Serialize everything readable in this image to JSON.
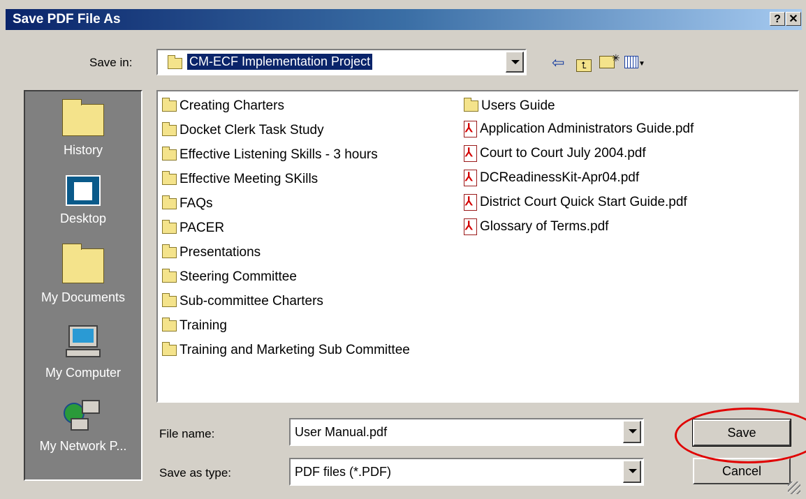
{
  "window": {
    "title": "Save PDF File As",
    "help_btn": "?",
    "close_btn": "✕"
  },
  "save_in": {
    "label": "Save in:",
    "value": "CM-ECF Implementation Project"
  },
  "places": [
    {
      "label": "History"
    },
    {
      "label": "Desktop"
    },
    {
      "label": "My Documents"
    },
    {
      "label": "My Computer"
    },
    {
      "label": "My Network P..."
    }
  ],
  "files_col1": [
    "Creating Charters",
    "Docket Clerk Task Study",
    "Effective Listening Skills - 3 hours",
    "Effective Meeting SKills",
    "FAQs",
    "PACER",
    "Presentations",
    "Steering Committee",
    "Sub-committee Charters",
    "Training",
    "Training and Marketing Sub Committee"
  ],
  "files_col2": [
    {
      "name": "Users Guide",
      "type": "folder"
    },
    {
      "name": "Application Administrators Guide.pdf",
      "type": "pdf"
    },
    {
      "name": "Court to Court July 2004.pdf",
      "type": "pdf"
    },
    {
      "name": "DCReadinessKit-Apr04.pdf",
      "type": "pdf"
    },
    {
      "name": "District Court Quick Start Guide.pdf",
      "type": "pdf"
    },
    {
      "name": "Glossary of Terms.pdf",
      "type": "pdf"
    }
  ],
  "file_name": {
    "label": "File name:",
    "value": "User Manual.pdf"
  },
  "save_type": {
    "label": "Save as type:",
    "value": "PDF files (*.PDF)"
  },
  "buttons": {
    "save": "Save",
    "cancel": "Cancel"
  },
  "colors": {
    "highlight": "#0a246a",
    "annotation": "#e00000"
  }
}
